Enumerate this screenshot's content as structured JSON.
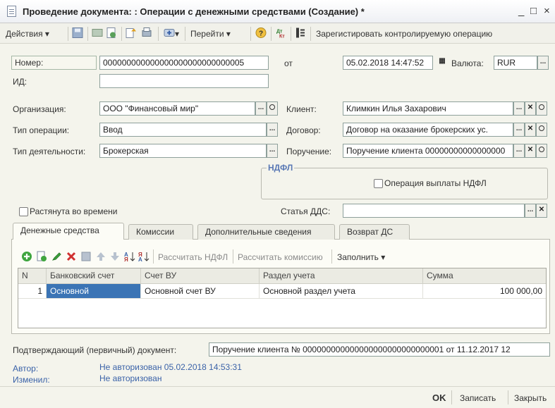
{
  "window": {
    "title": "Проведение документа: : Операции с денежными средствами (Создание) *",
    "minimize": "_",
    "maximize": "□",
    "close": "×"
  },
  "toolbar": {
    "actions": "Действия",
    "goto": "Перейти",
    "register": "Зарегистировать контролируемую операцию"
  },
  "form": {
    "number_label": "Номер:",
    "number_value": "000000000000000000000000000005",
    "from_label": "от",
    "date_value": "05.02.2018 14:47:52",
    "currency_label": "Валюта:",
    "currency_value": "RUR",
    "id_label": "ИД:",
    "id_value": "",
    "org_label": "Организация:",
    "org_value": "ООО \"Финансовый мир\"",
    "client_label": "Клиент:",
    "client_value": "Климкин Илья Захарович",
    "optype_label": "Тип операции:",
    "optype_value": "Ввод",
    "contract_label": "Договор:",
    "contract_value": "Договор на оказание брокерских ус.",
    "acttype_label": "Тип деятельности:",
    "acttype_value": "Брокерская",
    "order_label": "Поручение:",
    "order_value": "Поручение клиента 00000000000000000",
    "ndfl_group": "НДФЛ",
    "ndfl_check": "Операция выплаты НДФЛ",
    "stretch_check": "Растянута во времени",
    "dds_label": "Статья ДДС:",
    "dds_value": ""
  },
  "tabs": [
    {
      "label": "Денежные средства"
    },
    {
      "label": "Комиссии"
    },
    {
      "label": "Дополнительные сведения"
    },
    {
      "label": "Возврат ДС"
    }
  ],
  "grid_toolbar": {
    "calc_ndfl": "Рассчитать НДФЛ",
    "calc_commission": "Рассчитать комиссию",
    "fill": "Заполнить"
  },
  "table": {
    "headers": [
      "N",
      "Банковский счет",
      "Счет ВУ",
      "Раздел учета",
      "Сумма"
    ],
    "rows": [
      [
        "1",
        "Основной",
        "Основной счет ВУ",
        "Основной раздел учета",
        "100 000,00"
      ]
    ]
  },
  "bottom": {
    "primary_doc_label": "Подтверждающий (первичный) документ:",
    "primary_doc_value": "Поручение клиента № 000000000000000000000000000001 от 11.12.2017 12",
    "author_label": "Автор:",
    "author_value": "Не авторизован 05.02.2018 14:53:31",
    "changed_label": "Изменил:",
    "changed_value": "Не авторизован"
  },
  "footer": {
    "ok": "OK",
    "save": "Записать",
    "close": "Закрыть"
  }
}
